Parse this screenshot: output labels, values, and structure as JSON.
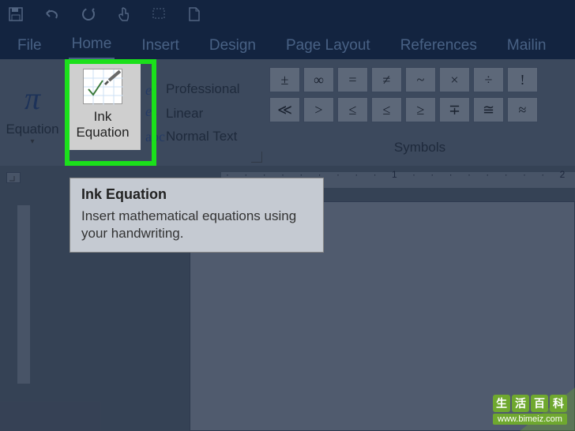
{
  "qat": {
    "icons": [
      "save",
      "undo",
      "redo",
      "touch-mode",
      "select-mode",
      "new-doc"
    ]
  },
  "tabs": {
    "items": [
      {
        "label": "File"
      },
      {
        "label": "Home"
      },
      {
        "label": "Insert"
      },
      {
        "label": "Design"
      },
      {
        "label": "Page Layout"
      },
      {
        "label": "References"
      },
      {
        "label": "Mailin"
      }
    ]
  },
  "ribbon": {
    "equation": {
      "label": "Equation"
    },
    "ink": {
      "label": "Ink\nEquation"
    },
    "options": [
      {
        "label": "Professional"
      },
      {
        "label": "Linear"
      },
      {
        "label": "Normal Text"
      }
    ],
    "symbols": {
      "label": "Symbols",
      "row1": [
        "±",
        "∞",
        "=",
        "≠",
        "~",
        "×",
        "÷",
        "!"
      ],
      "row2": [
        "≪",
        ">",
        "≤",
        "≤",
        "≥",
        "∓",
        "≅",
        "≈"
      ]
    }
  },
  "tooltip": {
    "title": "Ink Equation",
    "body": "Insert mathematical equations using your handwriting."
  },
  "ruler": {
    "marks": "· · · · · · · · · 1 · · · · · · · · 2 · ·"
  },
  "watermark": {
    "chars": [
      "生",
      "活",
      "百",
      "科"
    ],
    "url": "www.bimeiz.com"
  }
}
